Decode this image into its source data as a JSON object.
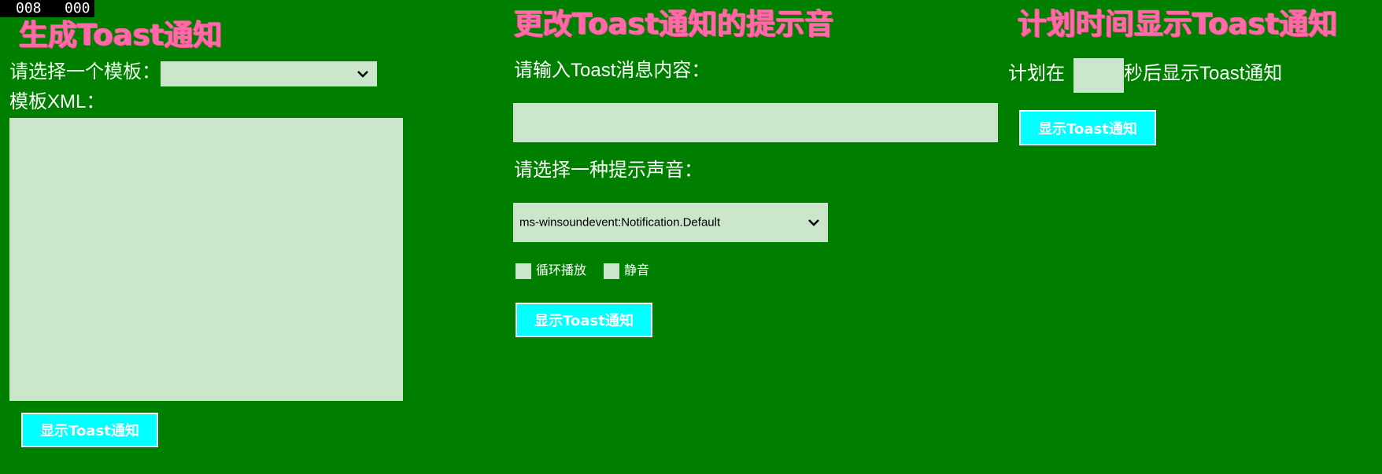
{
  "counter": {
    "left": "008",
    "right": "000"
  },
  "section1": {
    "title": "生成Toast通知",
    "template_label": "请选择一个模板：",
    "template_selected": "",
    "xml_label": "模板XML：",
    "xml_value": "",
    "show_button": "显示Toast通知"
  },
  "section2": {
    "title": "更改Toast通知的提示音",
    "message_label": "请输入Toast消息内容：",
    "message_value": "",
    "sound_label": "请选择一种提示声音：",
    "sound_selected": "ms-winsoundevent:Notification.Default",
    "loop_label": "循环播放",
    "mute_label": "静音",
    "show_button": "显示Toast通知"
  },
  "section3": {
    "title": "计划时间显示Toast通知",
    "prefix": "计划在",
    "seconds_value": "",
    "suffix": "秒后显示Toast通知",
    "show_button": "显示Toast通知"
  },
  "colors": {
    "background": "#007f00",
    "title": "#ff6aa8",
    "field": "#cce6cc",
    "button": "#00ffff"
  }
}
